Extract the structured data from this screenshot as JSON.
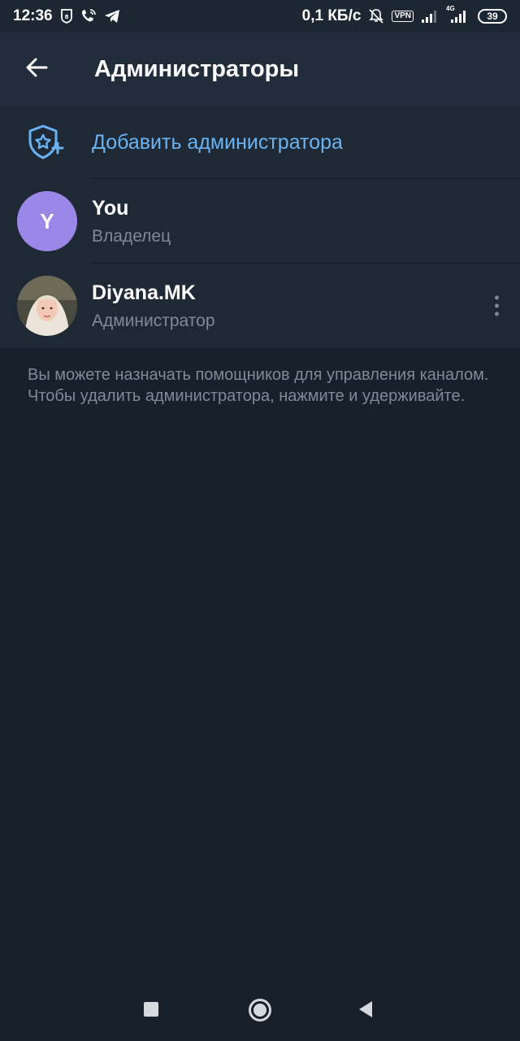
{
  "status_bar": {
    "time": "12:36",
    "network_speed": "0,1 КБ/с",
    "vpn_label": "VPN",
    "network_type": "4G",
    "battery": "39",
    "icons": [
      "shield-badge-icon",
      "wifi-calling-icon",
      "telegram-icon",
      "mute-bell-icon",
      "vpn-icon",
      "signal-icon",
      "signal-4g-icon",
      "battery-icon"
    ]
  },
  "app_bar": {
    "title": "Администраторы",
    "back_icon": "arrow-left-icon"
  },
  "add_admin": {
    "label": "Добавить администратора",
    "icon": "shield-star-plus-icon",
    "accent": "#6ab3f3"
  },
  "admins": [
    {
      "initial": "Y",
      "name": "You",
      "role": "Владелец",
      "avatar_color": "#9a87e8"
    },
    {
      "name": "Diyana.MK",
      "role": "Администратор",
      "avatar": "photo"
    }
  ],
  "info_text": "Вы можете назначать помощников для управления каналом. Чтобы удалить администратора, нажмите и удерживайте.",
  "nav_bar": {
    "icons": [
      "recents-square-icon",
      "home-circle-icon",
      "back-triangle-icon"
    ]
  }
}
